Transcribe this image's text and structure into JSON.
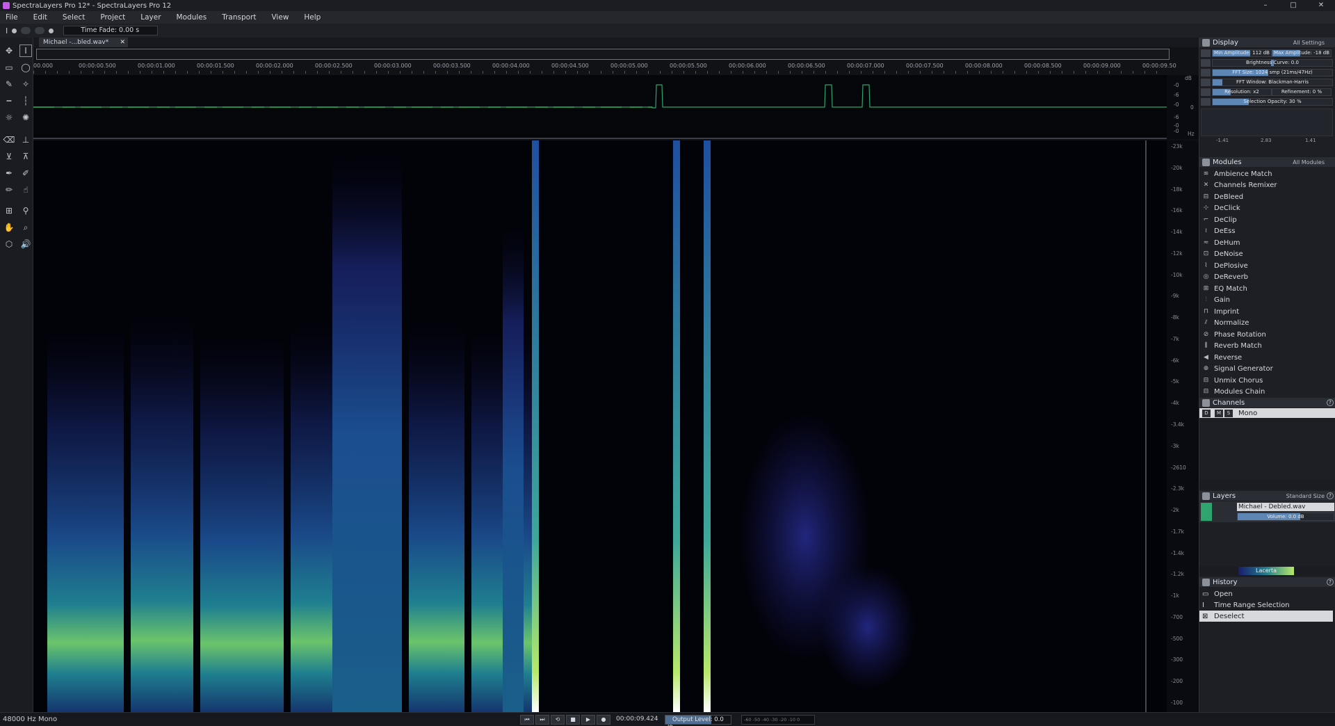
{
  "window": {
    "title": "SpectraLayers Pro 12* - SpectraLayers Pro 12",
    "controls": [
      "–",
      "□",
      "✕"
    ]
  },
  "menu": [
    "File",
    "Edit",
    "Select",
    "Project",
    "Layer",
    "Modules",
    "Transport",
    "View",
    "Help"
  ],
  "options": {
    "time_fade": "Time Fade: 0.00 s"
  },
  "document_tab": {
    "label": "Michael -...bled.wav*",
    "close": "✕"
  },
  "ruler": {
    "labels": [
      "00.000",
      "00:00:00.500",
      "00:00:01.000",
      "00:00:01.500",
      "00:00:02.000",
      "00:00:02.500",
      "00:00:03.000",
      "00:00:03.500",
      "00:00:04.000",
      "00:00:04.500",
      "00:00:05.000",
      "00:00:05.500",
      "00:00:06.000",
      "00:00:06.500",
      "00:00:07.000",
      "00:00:07.500",
      "00:00:08.000",
      "00:00:08.500",
      "00:00:09.000",
      "00:00:09.50"
    ]
  },
  "wave_scale": [
    "dB",
    "-0",
    "-6",
    "-0",
    "0",
    "-6",
    "-0",
    "-0",
    "Hz"
  ],
  "freq_scale": [
    "-23k",
    "-20k",
    "-18k",
    "-16k",
    "-14k",
    "-12k",
    "-10k",
    "-9k",
    "-8k",
    "-7k",
    "-6k",
    "-5k",
    "-4k",
    "-3.4k",
    "-3k",
    "-2610",
    "-2.3k",
    "-2k",
    "-1.7k",
    "-1.4k",
    "-1.2k",
    "-1k",
    "-700",
    "-500",
    "-300",
    "-200",
    "-100"
  ],
  "display": {
    "title": "Display",
    "settings": "All Settings",
    "min_amp": "Min Amplitude: 112 dB",
    "max_amp": "Max Amplitude: -18 dB",
    "brightness": "Brightness Curve: 0.0",
    "fft_size": "FFT Size: 1024 smp (21ms/47Hz)",
    "fft_window": "FFT Window: Blackman-Harris",
    "resolution": "Resolution: x2",
    "refinement": "Refinement: 0 %",
    "selection_opacity": "Selection Opacity: 30 %",
    "bottom_values": [
      "-1.41",
      "2.83",
      "1.41"
    ]
  },
  "modules": {
    "title": "Modules",
    "filter": "All Modules",
    "items": [
      "Ambience Match",
      "Channels Remixer",
      "DeBleed",
      "DeClick",
      "DeClip",
      "DeEss",
      "DeHum",
      "DeNoise",
      "DePlosive",
      "DeReverb",
      "EQ Match",
      "Gain",
      "Imprint",
      "Normalize",
      "Phase Rotation",
      "Reverb Match",
      "Reverse",
      "Signal Generator",
      "Unmix Chorus",
      "Modules Chain"
    ]
  },
  "channels": {
    "title": "Channels",
    "item": "Mono",
    "buttons": [
      "D",
      "M",
      "S"
    ]
  },
  "layers": {
    "title": "Layers",
    "size": "Standard Size",
    "layer_name": "Michael - Debled.wav",
    "volume": "Volume: 0.0 dB",
    "colormap": "Lacerta"
  },
  "history": {
    "title": "History",
    "items": [
      "Open",
      "Time Range Selection",
      "Deselect"
    ]
  },
  "status": {
    "format": "48000 Hz Mono",
    "time": "00:00:09.424",
    "output_level": "Output Level: 0.0 dB",
    "meter": "-60  -50  -40  -30  -20  -10   0"
  },
  "colors": {
    "spectro_low": "#1a2a7a",
    "spectro_mid": "#1f7f8f",
    "spectro_high": "#9ee85a",
    "accent": "#5d86b5"
  }
}
